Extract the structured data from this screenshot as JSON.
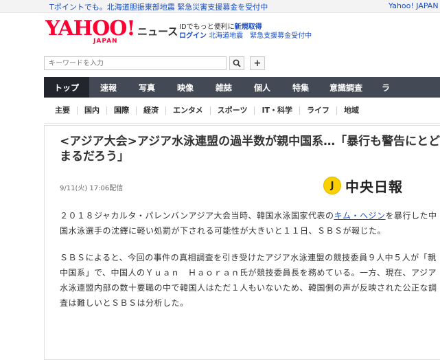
{
  "topbar": {
    "promo_text": "Tポイントでも。北海道胆振東部地震 緊急災害支援募金を受付中",
    "right_link": "Yahoo! JAPAN"
  },
  "header": {
    "logo_text": "YAHOO!",
    "logo_sub": "JAPAN",
    "service_name": "ニュース",
    "promo_line1": "IDでもっと便利に",
    "promo_line1_bold": "新規取得",
    "login": "ログイン",
    "promo_line2": "北海道地震　緊急支援募金受付中"
  },
  "search": {
    "placeholder": "キーワードを入力"
  },
  "nav": {
    "items": [
      {
        "label": "トップ",
        "active": true
      },
      {
        "label": "速報"
      },
      {
        "label": "写真"
      },
      {
        "label": "映像"
      },
      {
        "label": "雑誌"
      },
      {
        "label": "個人"
      },
      {
        "label": "特集"
      },
      {
        "label": "意識調査"
      },
      {
        "label": "ラ"
      }
    ]
  },
  "subnav": {
    "items": [
      "主要",
      "国内",
      "国際",
      "経済",
      "エンタメ",
      "スポーツ",
      "IT・科学",
      "ライフ",
      "地域"
    ]
  },
  "article": {
    "title": "<アジア大会>アジア水泳連盟の過半数が親中国系…「暴行も警告にとどまるだろう」",
    "date": "9/11(火) 17:06配信",
    "source_name": "中央日報",
    "source_mark": "J",
    "p1_a": "２０１８ジャカルタ・パレンバンアジア大会当時、韓国水泳国家代表の",
    "p1_link": "キム・ヘジン",
    "p1_b": "を暴行した中国水泳選手の沈鐸に軽い処罰が下される可能性が大きいと１１日、ＳＢＳが報じた。",
    "p2": "ＳＢＳによると、今回の事件の真相調査を引き受けたアジア水泳連盟の競技委員９人中５人が「親中国系」で、中国人のＹｕａｎ　Ｈａｏｒａｎ氏が競技委員長を務めている。一方、現在、アジア水泳連盟内部の数十要職の中で韓国人はただ１人もいないため、韓国側の声が反映された公正な調査は難しいとＳＢＳは分析した。"
  }
}
